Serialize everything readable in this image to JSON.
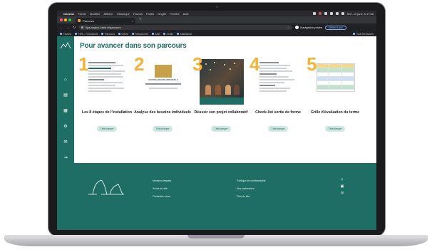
{
  "menubar": {
    "app_name": "Chrome",
    "items": [
      "Fichier",
      "Modifier",
      "Afficher",
      "Historique",
      "Favoris",
      "Profils",
      "Onglet",
      "Fenêtre",
      "Aide"
    ],
    "clock": "Mer. 10 janv. à 17:08"
  },
  "browser": {
    "tab_title": "Parcours",
    "url": "fipa-region-lorrie.fr/parcours",
    "private_label": "Navigation privée",
    "update_label": "Mettre à jour",
    "bookmarks": [
      "Favoris",
      "FIPA - Formations",
      "Parcours",
      "Offres",
      "Ressources",
      "Aide",
      "Outils",
      "Assistance"
    ],
    "all_bookmarks": "Tous les favoris"
  },
  "page": {
    "title": "Pour avancer dans son parcours",
    "download_label": "Télécharger",
    "steps": [
      {
        "num": "1",
        "title": "Les 8 étapes de l'installation"
      },
      {
        "num": "2",
        "title": "Analyse des besoins individuels"
      },
      {
        "num": "3",
        "title": "Réussir son projet collaboratif"
      },
      {
        "num": "4",
        "title": "Check-list sortie de forme"
      },
      {
        "num": "5",
        "title": "Grille d'évaluation du terme"
      }
    ],
    "thumb2_caption": "MATRICE BESOINS INDIVIDUELS"
  },
  "footer": {
    "col1": [
      "Mentions légales",
      "Accès au site",
      "Contactez-nous"
    ],
    "col2": [
      "Politique de confidentialité",
      "Nos partenaires",
      "Plan du site"
    ]
  },
  "colors": {
    "brand": "#1f6e65",
    "accent": "#f2b43a"
  }
}
